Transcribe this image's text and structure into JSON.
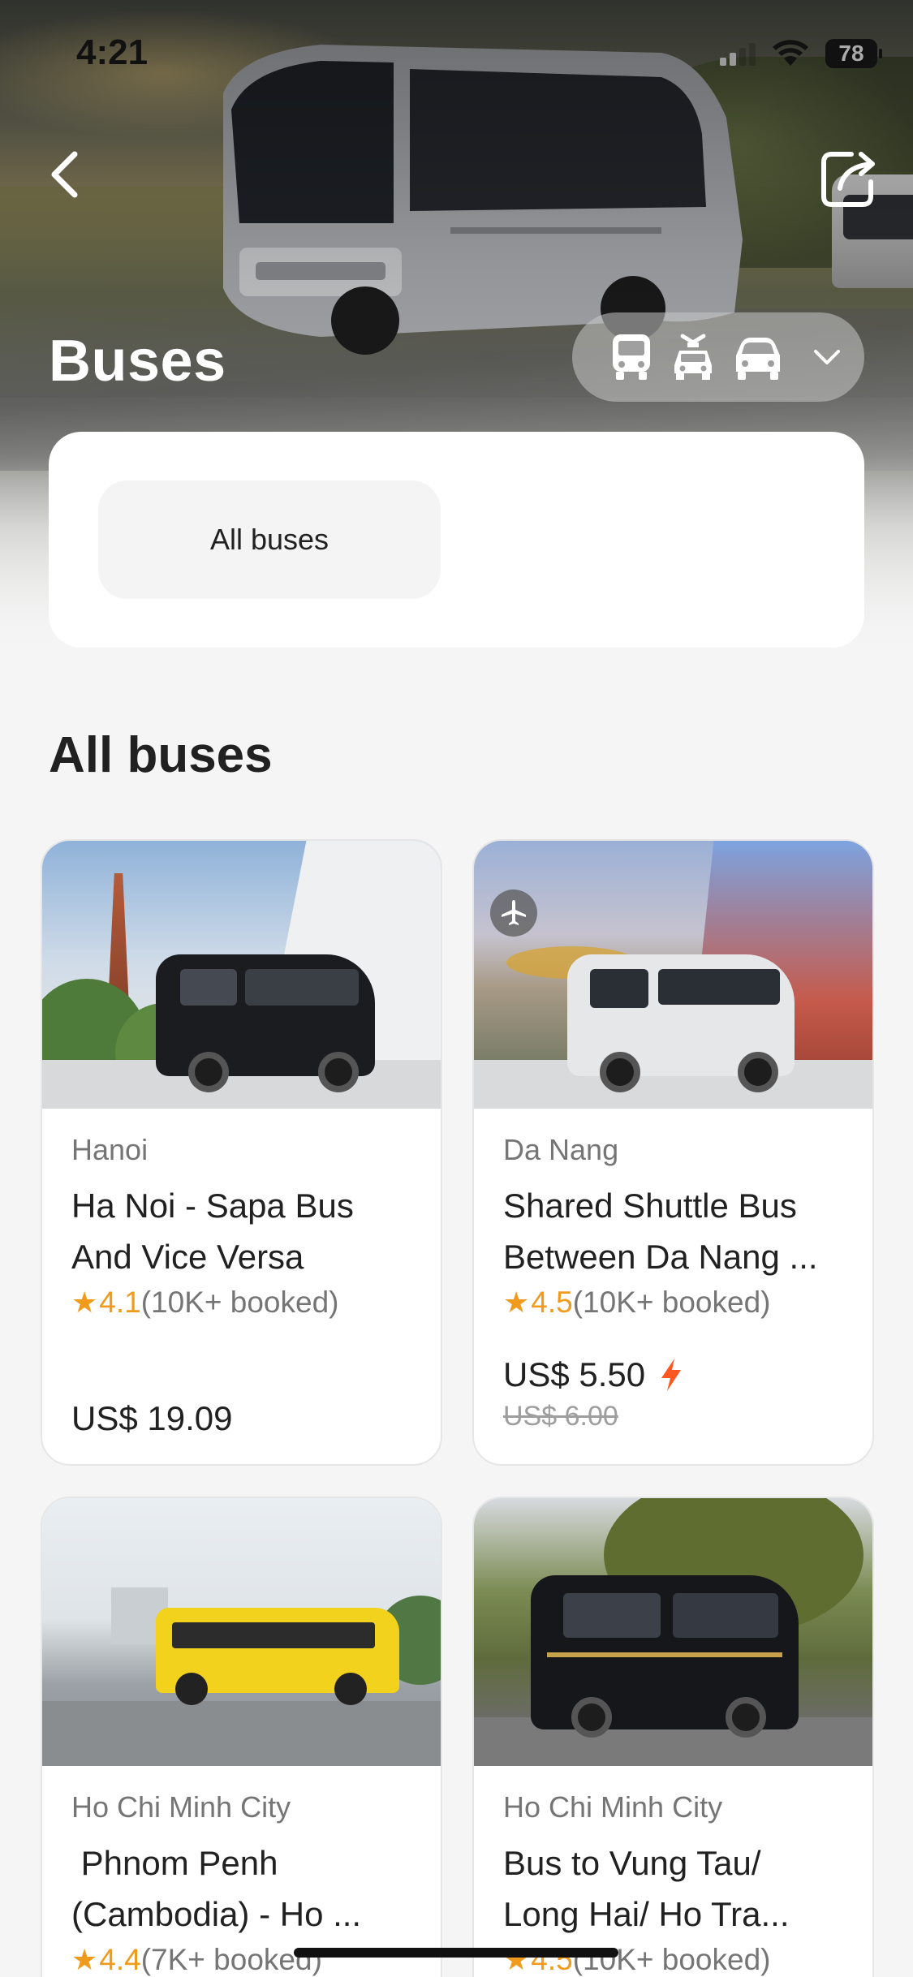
{
  "status_bar": {
    "time": "4:21",
    "battery": "78"
  },
  "header": {
    "title": "Buses"
  },
  "vehicle_switch": {
    "icons": [
      "bus-icon",
      "cable-car-icon",
      "car-icon"
    ],
    "dropdown": "chevron-down-icon"
  },
  "filter": {
    "chips": [
      "All buses"
    ]
  },
  "section": {
    "title": "All buses"
  },
  "products": [
    {
      "city": "Hanoi",
      "title": "Ha Noi - Sapa Bus And Vice Versa",
      "rating": "4.1",
      "booked": "(10K+ booked)",
      "price": "US$ 19.09",
      "old_price": ""
    },
    {
      "city": "Da Nang",
      "title": "Shared Shuttle Bus Between Da Nang ...",
      "rating": "4.5",
      "booked": "(10K+ booked)",
      "price": "US$ 5.50",
      "old_price": "US$ 6.00"
    },
    {
      "city": "Ho Chi Minh City",
      "title": " Phnom Penh (Cambodia) - Ho ...",
      "rating": "4.4",
      "booked": "(7K+ booked)",
      "price": "",
      "old_price": ""
    },
    {
      "city": "Ho Chi Minh City",
      "title": "Bus to Vung Tau/ Long Hai/ Ho Tra...",
      "rating": "4.5",
      "booked": "(10K+ booked)",
      "price": "",
      "old_price": ""
    }
  ],
  "colors": {
    "accent": "#f09b1b",
    "flash": "#ff5722",
    "background": "#f5f5f5"
  }
}
